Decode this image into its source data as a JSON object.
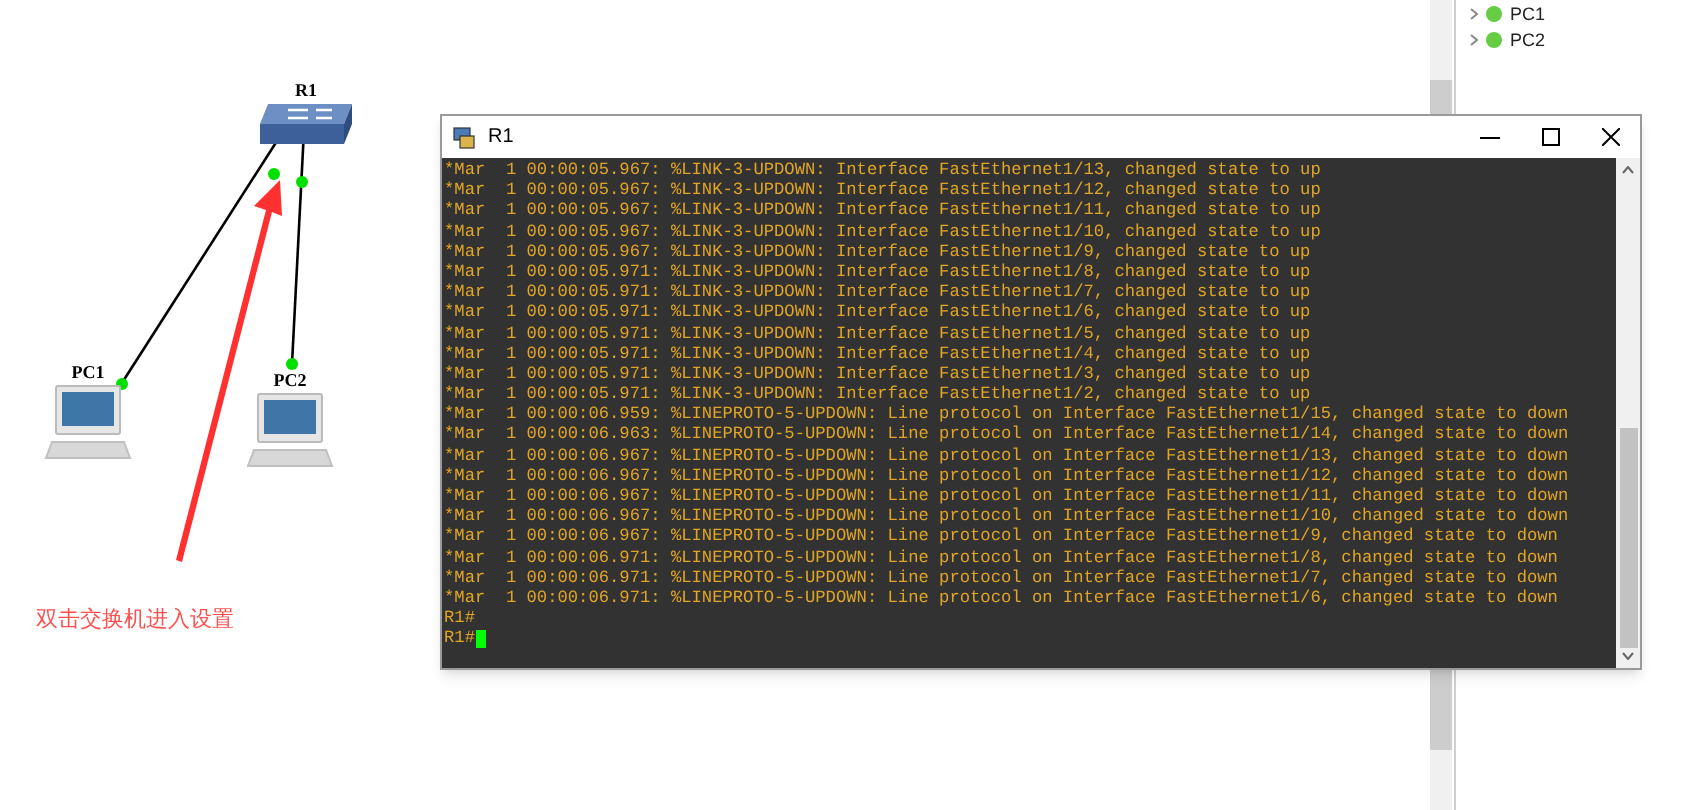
{
  "canvas": {
    "nodes": [
      {
        "kind": "switch",
        "label": "R1"
      },
      {
        "kind": "pc",
        "label": "PC1"
      },
      {
        "kind": "pc",
        "label": "PC2"
      }
    ],
    "annotation": "双击交换机进入设置"
  },
  "device_tree": [
    {
      "label": "PC1",
      "color": "#66cc44"
    },
    {
      "label": "PC2",
      "color": "#66cc44"
    }
  ],
  "terminal": {
    "title": "R1",
    "lines": [
      "*Mar  1 00:00:05.967: %LINK-3-UPDOWN: Interface FastEthernet1/13, changed state to up",
      "*Mar  1 00:00:05.967: %LINK-3-UPDOWN: Interface FastEthernet1/12, changed state to up",
      "*Mar  1 00:00:05.967: %LINK-3-UPDOWN: Interface FastEthernet1/11, changed state to up",
      "*Mar  1 00:00:05.967: %LINK-3-UPDOWN: Interface FastEthernet1/10, changed state to up",
      "*Mar  1 00:00:05.967: %LINK-3-UPDOWN: Interface FastEthernet1/9, changed state to up",
      "*Mar  1 00:00:05.971: %LINK-3-UPDOWN: Interface FastEthernet1/8, changed state to up",
      "*Mar  1 00:00:05.971: %LINK-3-UPDOWN: Interface FastEthernet1/7, changed state to up",
      "*Mar  1 00:00:05.971: %LINK-3-UPDOWN: Interface FastEthernet1/6, changed state to up",
      "*Mar  1 00:00:05.971: %LINK-3-UPDOWN: Interface FastEthernet1/5, changed state to up",
      "*Mar  1 00:00:05.971: %LINK-3-UPDOWN: Interface FastEthernet1/4, changed state to up",
      "*Mar  1 00:00:05.971: %LINK-3-UPDOWN: Interface FastEthernet1/3, changed state to up",
      "*Mar  1 00:00:05.971: %LINK-3-UPDOWN: Interface FastEthernet1/2, changed state to up",
      "*Mar  1 00:00:06.959: %LINEPROTO-5-UPDOWN: Line protocol on Interface FastEthernet1/15, changed state to down",
      "*Mar  1 00:00:06.963: %LINEPROTO-5-UPDOWN: Line protocol on Interface FastEthernet1/14, changed state to down",
      "*Mar  1 00:00:06.967: %LINEPROTO-5-UPDOWN: Line protocol on Interface FastEthernet1/13, changed state to down",
      "*Mar  1 00:00:06.967: %LINEPROTO-5-UPDOWN: Line protocol on Interface FastEthernet1/12, changed state to down",
      "*Mar  1 00:00:06.967: %LINEPROTO-5-UPDOWN: Line protocol on Interface FastEthernet1/11, changed state to down",
      "*Mar  1 00:00:06.967: %LINEPROTO-5-UPDOWN: Line protocol on Interface FastEthernet1/10, changed state to down",
      "*Mar  1 00:00:06.967: %LINEPROTO-5-UPDOWN: Line protocol on Interface FastEthernet1/9, changed state to down",
      "*Mar  1 00:00:06.971: %LINEPROTO-5-UPDOWN: Line protocol on Interface FastEthernet1/8, changed state to down",
      "*Mar  1 00:00:06.971: %LINEPROTO-5-UPDOWN: Line protocol on Interface FastEthernet1/7, changed state to down",
      "*Mar  1 00:00:06.971: %LINEPROTO-5-UPDOWN: Line protocol on Interface FastEthernet1/6, changed state to down",
      "R1#",
      "R1#"
    ]
  }
}
